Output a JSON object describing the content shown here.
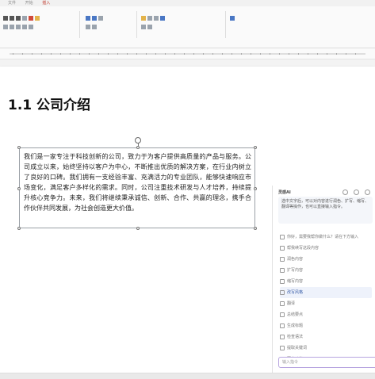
{
  "menu": [
    "文件",
    "开始",
    "插入"
  ],
  "ribbon": {
    "groups": [
      "剪贴板",
      "字体",
      "段落",
      "样式",
      "编辑"
    ]
  },
  "document": {
    "heading": "1.1 公司介绍",
    "textbox_paragraph": "我们是一家专注于科技创新的公司，致力于为客户提供高质量的产品与服务。公司成立以来，始终坚持以客户为中心，不断推出优质的解决方案，在行业内树立了良好的口碑。我们拥有一支经验丰富、充满活力的专业团队，能够快速响应市场变化，满足客户多样化的需求。同时，公司注重技术研发与人才培养，持续提升核心竞争力。未来，我们将继续秉承诚信、创新、合作、共赢的理念，携手合作伙伴共同发展，为社会创造更大价值。"
  },
  "side_panel": {
    "title": "灵感AI",
    "card_text": "选中文字后，可以对内容进行润色、扩写、缩写、翻译等操作，也可以直接输入指令。",
    "items": [
      {
        "label": "你好，需要我帮你做什么？请在下方输入",
        "selected": false
      },
      {
        "label": "帮我续写这段内容",
        "selected": false
      },
      {
        "label": "润色内容",
        "selected": false
      },
      {
        "label": "扩写内容",
        "selected": false
      },
      {
        "label": "缩写内容",
        "selected": false
      },
      {
        "label": "改写风格",
        "selected": true
      },
      {
        "label": "翻译",
        "selected": false
      },
      {
        "label": "总结要点",
        "selected": false
      },
      {
        "label": "生成标题",
        "selected": false
      },
      {
        "label": "检查语法",
        "selected": false
      },
      {
        "label": "提取关键词",
        "selected": false
      },
      {
        "label": "更多功能",
        "selected": false
      }
    ],
    "input_placeholder": "输入指令"
  }
}
